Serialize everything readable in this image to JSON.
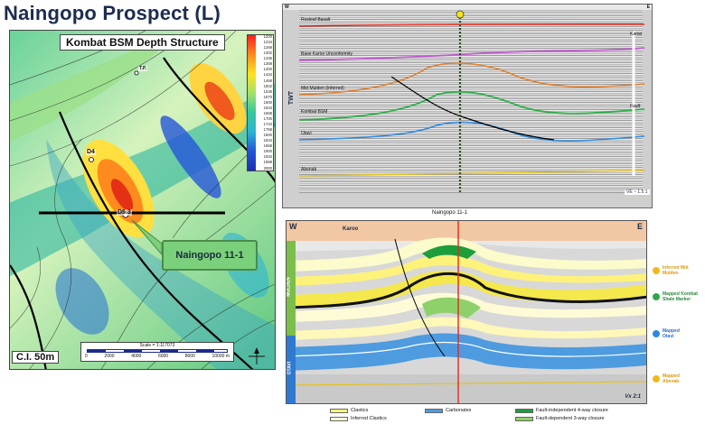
{
  "page": {
    "title": "Naingopo Prospect (L)"
  },
  "map": {
    "title": "Kombat BSM Depth Structure",
    "colorbar_ticks": [
      "1200",
      "1234",
      "1268",
      "1302",
      "1336",
      "1368",
      "1400",
      "1434",
      "1468",
      "1502",
      "1536",
      "1570",
      "1600",
      "1634",
      "1668",
      "1700",
      "1734",
      "1768",
      "1800",
      "1834",
      "1868",
      "1900",
      "1934",
      "1968",
      "2000"
    ],
    "well_d4": "D4",
    "well_d53": "D5.3",
    "well_t": "T.P.",
    "callout": "Naingopo 11-1",
    "scale_label": "Scale = 1:117073",
    "scale_ticks": [
      "0",
      "2000",
      "4000",
      "6000",
      "8000",
      "10000 m"
    ],
    "ci_label": "C.I. 50m",
    "north": "N"
  },
  "seismic": {
    "west": "W",
    "east": "E",
    "twt": "TWT",
    "horizons": [
      "Rosleaf Basalt",
      "Base Karoo Unconformity",
      "Mid Mulden (Inferred)",
      "Kombat BSM",
      "Otavi",
      "Abenab"
    ],
    "karoo_tag": "Karoo",
    "fault_tag": "Fault",
    "ve": "VE ~ 1.5:1",
    "caption": "Naingopo 11-1"
  },
  "xsection": {
    "west": "W",
    "east": "E",
    "karoo": "Karoo",
    "mulden": "MULDEN",
    "otavi": "OTAVI",
    "ve": "Vx 2:1"
  },
  "legend": {
    "clastics": "Clastics",
    "inferred": "Inferred Clastics",
    "carbonates": "Carbonates",
    "fault_ind": "Fault-independent 4-way closure",
    "fault_dep": "Fault-dependent 3-way closure"
  },
  "annotations": [
    {
      "text": "Inferred Mid Mulden",
      "color": "#f1b81d"
    },
    {
      "text": "Mapped Kombat Shale Marker",
      "color": "#2fa84a"
    },
    {
      "text": "Mapped Otavi",
      "color": "#2a88e0"
    },
    {
      "text": "Mapped Abenab",
      "color": "#f1b81d"
    }
  ]
}
